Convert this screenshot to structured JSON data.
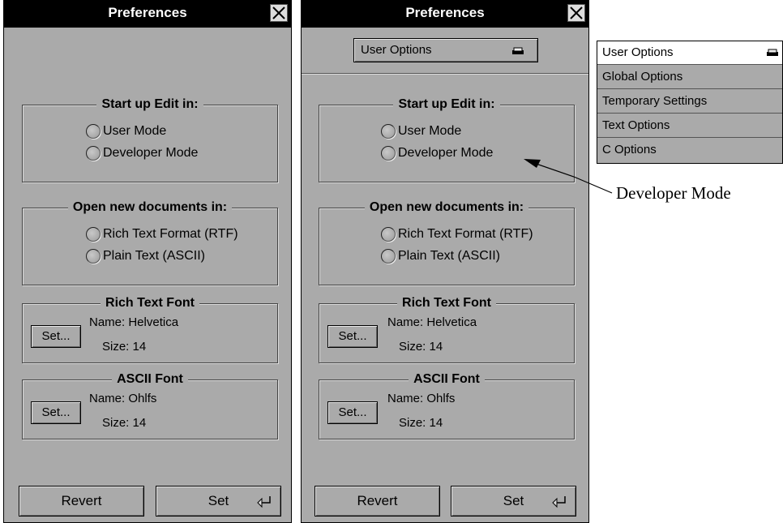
{
  "left_panel": {
    "title": "Preferences",
    "startup": {
      "legend": "Start up Edit in:",
      "options": [
        "User Mode",
        "Developer Mode"
      ]
    },
    "open_docs": {
      "legend": "Open new documents in:",
      "options": [
        "Rich Text Format (RTF)",
        "Plain Text (ASCII)"
      ]
    },
    "rich_font": {
      "legend": "Rich Text Font",
      "set_label": "Set...",
      "name": "Name: Helvetica",
      "size": "Size:  14"
    },
    "ascii_font": {
      "legend": "ASCII Font",
      "set_label": "Set...",
      "name": "Name: Ohlfs",
      "size": "Size:  14"
    },
    "revert_label": "Revert",
    "set_label": "Set"
  },
  "right_panel": {
    "title": "Preferences",
    "selector_value": "User Options",
    "startup": {
      "legend": "Start up Edit in:",
      "options": [
        "User Mode",
        "Developer Mode"
      ]
    },
    "open_docs": {
      "legend": "Open new documents in:",
      "options": [
        "Rich Text Format (RTF)",
        "Plain Text (ASCII)"
      ]
    },
    "rich_font": {
      "legend": "Rich Text Font",
      "set_label": "Set...",
      "name": "Name: Helvetica",
      "size": "Size:  14"
    },
    "ascii_font": {
      "legend": "ASCII Font",
      "set_label": "Set...",
      "name": "Name: Ohlfs",
      "size": "Size:  14"
    },
    "revert_label": "Revert",
    "set_label": "Set"
  },
  "popup_menu": {
    "items": [
      "User Options",
      "Global Options",
      "Temporary Settings",
      "Text Options",
      "C Options"
    ]
  },
  "annotation": {
    "label": "Developer Mode"
  }
}
